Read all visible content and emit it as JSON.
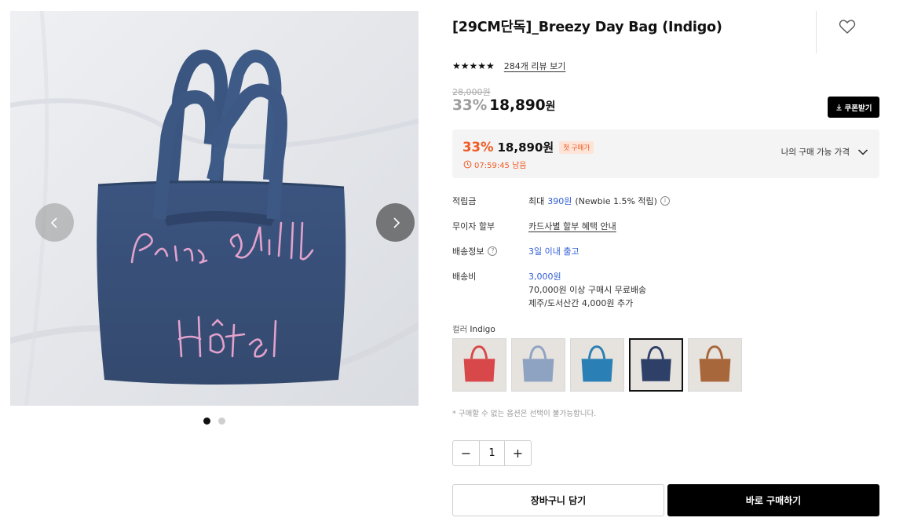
{
  "product": {
    "title": "[29CM단독]_Breezy Day Bag (Indigo)",
    "stars": "★★★★★",
    "review_link": "284개 리뷰 보기",
    "rating": 5,
    "original_price": "28,000원",
    "discount": "33%",
    "price": "18,890",
    "price_unit": "원",
    "coupon_button": "쿠폰받기"
  },
  "my_price": {
    "discount": "33%",
    "price": "18,890원",
    "badge": "첫 구매가",
    "timer": "07:59:45 남음",
    "toggle_label": "나의 구매 가능 가격"
  },
  "specs": {
    "points_label": "적립금",
    "points_prefix": "최대",
    "points_value": "390원",
    "points_suffix": "(Newbie 1.5% 적립)",
    "installment_label": "무이자 할부",
    "installment_link": "카드사별 할부 혜택 안내",
    "shipping_info_label": "배송정보",
    "shipping_info_value": "3일 이내 출고",
    "shipping_fee_label": "배송비",
    "shipping_fee_value": "3,000원",
    "shipping_fee_note1": "70,000원 이상 구매시 무료배송",
    "shipping_fee_note2": "제주/도서산간 4,000원 추가"
  },
  "color_option": {
    "label": "컬러",
    "selected": "Indigo",
    "swatch_colors": [
      "#d8484a",
      "#8ea3c2",
      "#2a7fb4",
      "#2e3f68",
      "#a8673a"
    ],
    "selected_index": 3
  },
  "notice": "* 구매할 수 없는 옵션은 선택이 불가능합니다.",
  "quantity": {
    "minus": "−",
    "value": "1",
    "plus": "+"
  },
  "actions": {
    "cart": "장바구니 담기",
    "buy": "바로 구매하기"
  },
  "gallery": {
    "image_text_line1": "Paris chill",
    "image_text_line2": "Hôtel",
    "slide_count": 2,
    "active_slide": 0
  },
  "icons": {
    "heart": "heart-icon",
    "prev": "chevron-left-icon",
    "next": "chevron-right-icon",
    "download": "download-icon",
    "clock": "clock-icon",
    "chevron_down": "chevron-down-icon",
    "info": "info-icon",
    "help": "help-icon"
  },
  "colors": {
    "accent": "#f05a23",
    "link_blue": "#2f5dd6",
    "bag": "#3f5c86",
    "embroidery": "#e4a6cf"
  }
}
